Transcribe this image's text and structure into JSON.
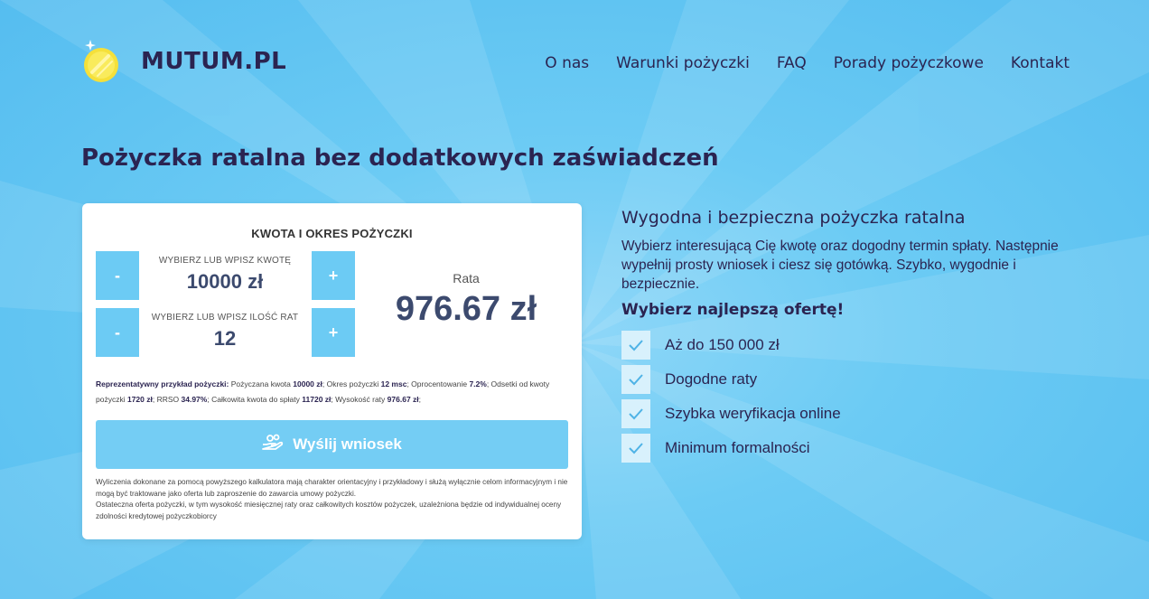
{
  "header": {
    "logo_text": "MUTUM.PL",
    "nav": [
      "O nas",
      "Warunki pożyczki",
      "FAQ",
      "Porady pożyczkowe",
      "Kontakt"
    ]
  },
  "page_title": "Pożyczka ratalna bez dodatkowych zaświadczeń",
  "calculator": {
    "heading": "KWOTA I OKRES POŻYCZKI",
    "amount": {
      "label": "WYBIERZ LUB WPISZ KWOTĘ",
      "value": "10000 zł",
      "minus": "-",
      "plus": "+"
    },
    "installments": {
      "label": "WYBIERZ LUB WPISZ ILOŚĆ RAT",
      "value": "12",
      "minus": "-",
      "plus": "+"
    },
    "rata_label": "Rata",
    "rata_value": "976.67 zł",
    "example": {
      "lead": "Reprezentatywny przykład pożyczki:",
      "t1": " Pożyczana kwota ",
      "v1": "10000 zł",
      "t2": "; Okres pożyczki ",
      "v2": "12 msc",
      "t3": "; Oprocentowanie ",
      "v3": "7.2%",
      "t4": "; Odsetki od kwoty pożyczki ",
      "v4": "1720 zł",
      "t5": "; RRSO ",
      "v5": "34.97%",
      "t6": "; Całkowita kwota do spłaty ",
      "v6": "11720 zł",
      "t7": "; Wysokość raty ",
      "v7": "976.67 zł",
      "t8": ";"
    },
    "send_label": "Wyślij wniosek",
    "disclaimer_1": "Wyliczenia dokonane za pomocą powyższego kalkulatora mają charakter orientacyjny i przykładowy i służą wyłącznie celom informacyjnym i nie mogą być traktowane jako oferta lub zaproszenie do zawarcia umowy pożyczki.",
    "disclaimer_2": "Ostateczna oferta pożyczki, w tym wysokość miesięcznej raty oraz całkowitych kosztów pożyczek, uzależniona będzie od indywidualnej oceny zdolności kredytowej pożyczkobiorcy"
  },
  "info": {
    "title": "Wygodna i bezpieczna pożyczka ratalna",
    "description": "Wybierz interesującą Cię kwotę oraz dogodny termin spłaty. Następnie wypełnij prosty wniosek i ciesz się gotówką. Szybko, wygodnie i bezpiecznie.",
    "subtitle": "Wybierz najlepszą ofertę!",
    "features": [
      "Aż do 150 000 zł",
      "Dogodne raty",
      "Szybka weryfikacja online",
      "Minimum formalności"
    ]
  },
  "colors": {
    "background": "#5fc4f3",
    "accent": "#6ccbf4",
    "text": "#2b2451",
    "coin": "#f5e03a"
  },
  "icons": [
    "coin-logo-icon",
    "check-icon",
    "hand-coins-icon"
  ]
}
